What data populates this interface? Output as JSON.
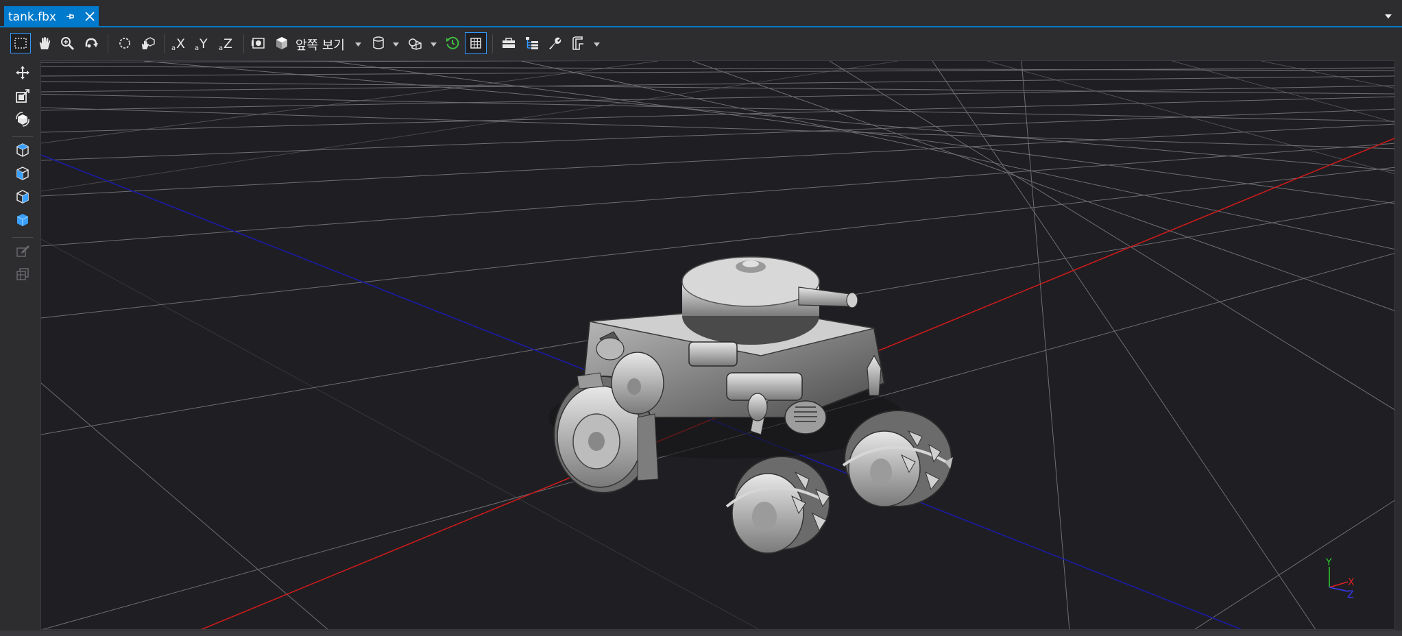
{
  "tab": {
    "title": "tank.fbx"
  },
  "toolbar": {
    "view_label": "앞쪽 보기"
  },
  "colors": {
    "accent": "#007acc",
    "active_border": "#3399ff",
    "axis_x": "#cc1a1a",
    "axis_z": "#1a1aa8",
    "gizmo_y": "#2bd12b",
    "gizmo_x": "#e02020",
    "gizmo_z": "#3a3aff",
    "viewport_bg": "#1f1f23"
  },
  "icons": {
    "toolbar": [
      "select-rect-icon",
      "pan-hand-icon",
      "zoom-icon",
      "orbit-icon",
      "lasso-select-icon",
      "pan-hand-cube-icon",
      "scale-x-icon",
      "scale-y-icon",
      "scale-z-icon",
      "frame-camera-icon",
      "view-cube-icon",
      "draw-mode-icon",
      "lighting-icon",
      "realtime-refresh-icon",
      "grid-toggle-icon",
      "toolbox-icon",
      "scene-graph-icon",
      "wrench-icon",
      "more-options-icon"
    ],
    "left": [
      "move-icon",
      "scale-icon",
      "rotate-icon",
      "add-cube-icon",
      "add-cylinder-icon",
      "add-cone-icon",
      "add-sphere-icon",
      "edit-disabled-icon",
      "group-disabled-icon"
    ]
  },
  "gizmo": {
    "y": "Y",
    "x": "X",
    "z": "Z"
  }
}
